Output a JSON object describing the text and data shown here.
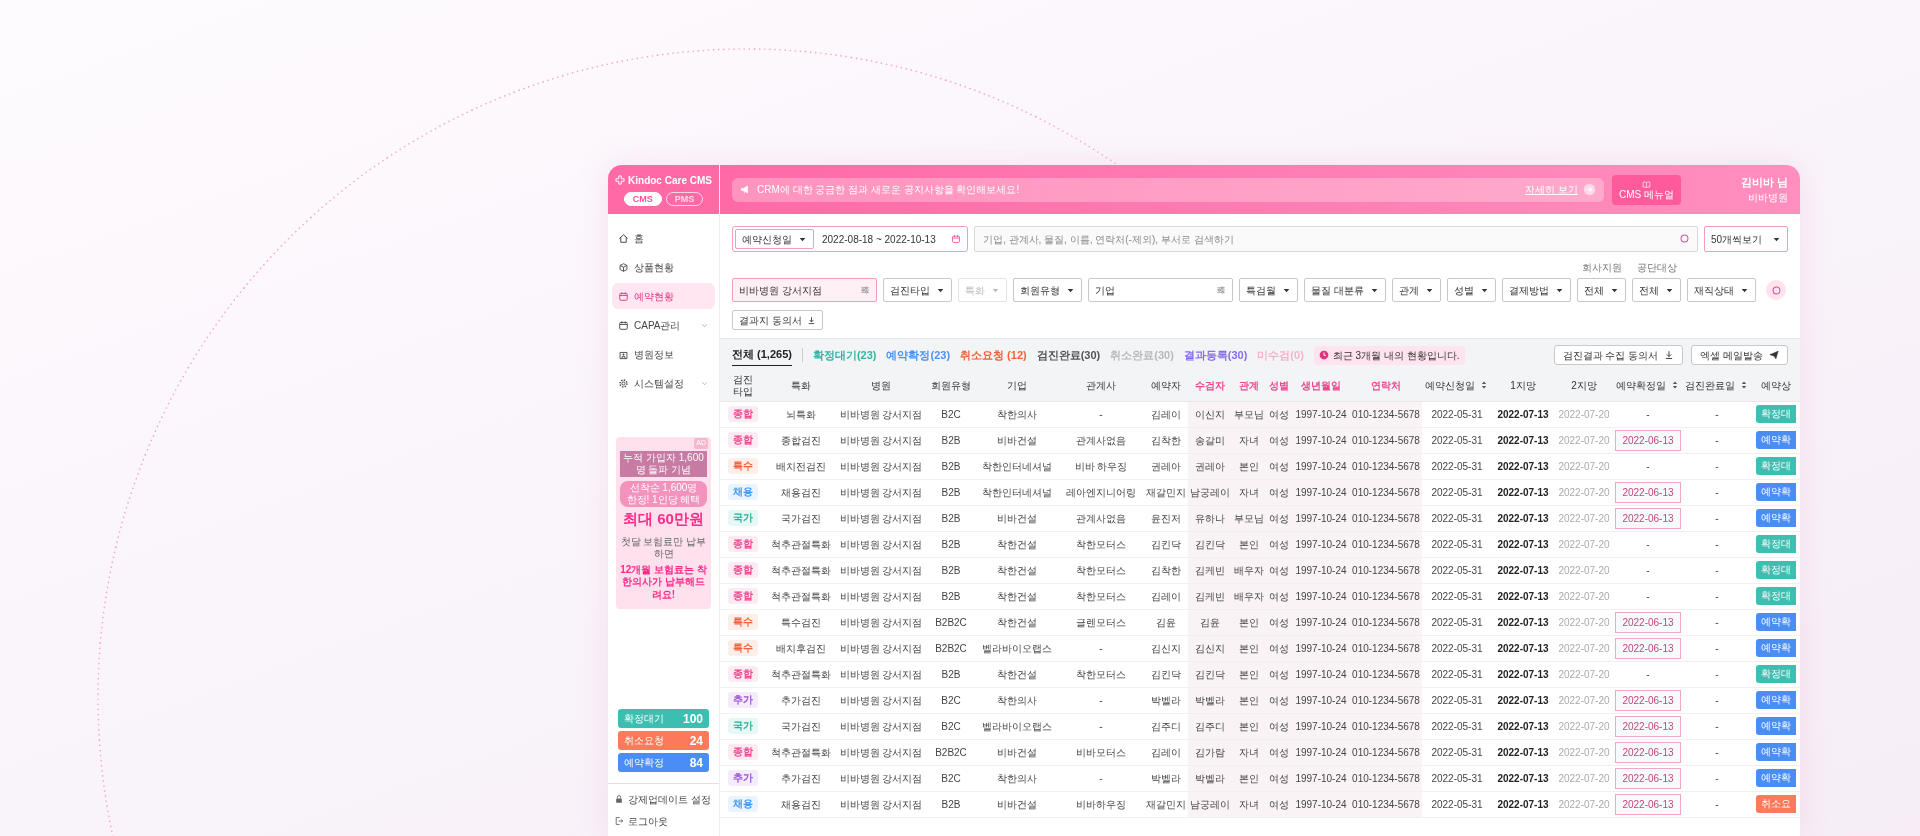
{
  "sidebar": {
    "logo": "Kindoc Care CMS",
    "modes": [
      {
        "label": "CMS",
        "selected": true
      },
      {
        "label": "PMS",
        "selected": false
      }
    ],
    "menu": [
      {
        "label": "홈",
        "kind": "home",
        "selected": false,
        "expandable": false
      },
      {
        "label": "상품현황",
        "kind": "product",
        "selected": false,
        "expandable": false
      },
      {
        "label": "예약현황",
        "kind": "reservation",
        "selected": true,
        "expandable": false
      },
      {
        "label": "CAPA관리",
        "kind": "capa",
        "selected": false,
        "expandable": true
      },
      {
        "label": "병원정보",
        "kind": "hospital",
        "selected": false,
        "expandable": false
      },
      {
        "label": "시스템설정",
        "kind": "settings",
        "selected": false,
        "expandable": true
      }
    ],
    "ad": {
      "tag": "AD",
      "ribbon": "누적 가입자 1,600명 돌파 기념",
      "offer": "선착순 1,600명 한정! 1인당 혜택",
      "headline": "최대 60만원",
      "note": "첫달 보험료만 납부하면",
      "promise": "12개월 보험료는 착한의사가 납부해드려요!"
    },
    "counters": [
      {
        "label": "확정대기",
        "count": "100",
        "color": "#3cbfb0"
      },
      {
        "label": "취소요청",
        "count": "24",
        "color": "#fb7a5b"
      },
      {
        "label": "예약확정",
        "count": "84",
        "color": "#4a8ef5"
      }
    ],
    "links": [
      {
        "label": "강제업데이트 설정",
        "kind": "lock"
      },
      {
        "label": "로그아웃",
        "kind": "logout"
      }
    ]
  },
  "header": {
    "notice": "CRM에 대한 궁금한 점과 새로운 공지사항을 확인해보세요!",
    "more": "자세히 보기",
    "manual": "CMS 메뉴얼",
    "user": "김비바 님",
    "org": "비바병원"
  },
  "filters": {
    "date_type": "예약신청일",
    "date_range": "2022-08-18 ~ 2022-10-13",
    "search_placeholder": "기업, 관계사, 물질, 이름, 연락처(-제외), 부서로 검색하기",
    "page_size": "50개씩보기",
    "controls": [
      {
        "kind": "field",
        "value": "비바병원 강서지점",
        "active": true,
        "disabled": false
      },
      {
        "kind": "select",
        "value": "검진타입",
        "active": false,
        "disabled": false
      },
      {
        "kind": "select",
        "value": "특화",
        "active": false,
        "disabled": true
      },
      {
        "kind": "select",
        "value": "회원유형",
        "active": false,
        "disabled": false
      },
      {
        "kind": "field",
        "value": "기업",
        "active": false,
        "disabled": false
      },
      {
        "kind": "select",
        "value": "특검월",
        "active": false,
        "disabled": false
      },
      {
        "kind": "select",
        "value": "물질 대분류",
        "active": false,
        "disabled": false
      },
      {
        "kind": "select",
        "value": "관계",
        "active": false,
        "disabled": false
      },
      {
        "kind": "select",
        "value": "성별",
        "active": false,
        "disabled": false
      },
      {
        "kind": "select",
        "value": "결제방법",
        "active": false,
        "disabled": false
      },
      {
        "kind": "select",
        "caption": "회사지원",
        "value": "전체",
        "active": false,
        "disabled": false
      },
      {
        "kind": "select",
        "caption": "공단대상",
        "value": "전체",
        "active": false,
        "disabled": false
      },
      {
        "kind": "select",
        "value": "재직상태",
        "active": false,
        "disabled": false
      }
    ],
    "consent_button": "결과지 동의서"
  },
  "status_tabs": [
    {
      "label": "전체 (1,265)",
      "selected": true,
      "color": "#222222"
    },
    {
      "label": "확정대기(23)",
      "selected": false,
      "color": "#2fb5a5"
    },
    {
      "label": "예약확정(23)",
      "selected": false,
      "color": "#4a93f5"
    },
    {
      "label": "취소요청 (12)",
      "selected": false,
      "color": "#f5603c"
    },
    {
      "label": "검진완료(30)",
      "selected": false,
      "color": "#555555"
    },
    {
      "label": "취소완료(30)",
      "selected": false,
      "color": "#b8b8b8"
    },
    {
      "label": "결과등록(30)",
      "selected": false,
      "color": "#8a6cf0"
    },
    {
      "label": "미수검(0)",
      "selected": false,
      "color": "#f5b3cd"
    }
  ],
  "info_pill": "최근 3개월 내의 현황입니다.",
  "actions": [
    {
      "label": "검진결과 수집 동의서",
      "kind": "download"
    },
    {
      "label": "엑셀 메일발송",
      "kind": "send"
    }
  ],
  "table": {
    "columns": [
      {
        "label": "검진 타입",
        "highlight": false,
        "sortable": false
      },
      {
        "label": "특화",
        "highlight": false,
        "sortable": false
      },
      {
        "label": "병원",
        "highlight": false,
        "sortable": false
      },
      {
        "label": "회원유형",
        "highlight": false,
        "sortable": false
      },
      {
        "label": "기업",
        "highlight": false,
        "sortable": false
      },
      {
        "label": "관계사",
        "highlight": false,
        "sortable": false
      },
      {
        "label": "예약자",
        "highlight": false,
        "sortable": false
      },
      {
        "label": "수검자",
        "highlight": true,
        "sortable": false
      },
      {
        "label": "관계",
        "highlight": true,
        "sortable": false
      },
      {
        "label": "성별",
        "highlight": true,
        "sortable": false
      },
      {
        "label": "생년월일",
        "highlight": true,
        "sortable": false
      },
      {
        "label": "연락처",
        "highlight": true,
        "sortable": false
      },
      {
        "label": "예약신청일",
        "highlight": false,
        "sortable": true
      },
      {
        "label": "1지망",
        "highlight": false,
        "sortable": false
      },
      {
        "label": "2지망",
        "highlight": false,
        "sortable": false
      },
      {
        "label": "예약확정일",
        "highlight": false,
        "sortable": true
      },
      {
        "label": "검진완료일",
        "highlight": false,
        "sortable": true
      },
      {
        "label": "예약상",
        "highlight": false,
        "sortable": false
      }
    ],
    "rows": [
      {
        "type": {
          "label": "종합",
          "color": "#f0468f"
        },
        "specialty": "뇌특화",
        "hospital": "비바병원 강서지점",
        "member_type": "B2C",
        "company": "착한의사",
        "affiliate": "-",
        "booker": "김레이",
        "examinee": "이신지",
        "relation": "부모님",
        "sex": "여성",
        "birth": "1997-10-24",
        "phone": "010-1234-5678",
        "requested": "2022-05-31",
        "choice_1": "2022-07-13",
        "choice_2": "2022-07-20",
        "confirmed": {
          "text": "-",
          "boxed": false
        },
        "completed": "-",
        "status": {
          "label": "확정대",
          "color": "#3cbfb0"
        }
      },
      {
        "type": {
          "label": "종합",
          "color": "#f0468f"
        },
        "specialty": "종합검진",
        "hospital": "비바병원 강서지점",
        "member_type": "B2B",
        "company": "비바건설",
        "affiliate": "관계사없음",
        "booker": "김착한",
        "examinee": "송갈미",
        "relation": "자녀",
        "sex": "여성",
        "birth": "1997-10-24",
        "phone": "010-1234-5678",
        "requested": "2022-05-31",
        "choice_1": "2022-07-13",
        "choice_2": "2022-07-20",
        "confirmed": {
          "text": "2022-06-13",
          "boxed": true
        },
        "completed": "-",
        "status": {
          "label": "예약확",
          "color": "#4a8ef5"
        }
      },
      {
        "type": {
          "label": "특수",
          "color": "#f5603c"
        },
        "specialty": "배치전검진",
        "hospital": "비바병원 강서지점",
        "member_type": "B2B",
        "company": "착한인터네셔널",
        "affiliate": "비바 하우징",
        "booker": "권레아",
        "examinee": "권레아",
        "relation": "본인",
        "sex": "여성",
        "birth": "1997-10-24",
        "phone": "010-1234-5678",
        "requested": "2022-05-31",
        "choice_1": "2022-07-13",
        "choice_2": "2022-07-20",
        "confirmed": {
          "text": "-",
          "boxed": false
        },
        "completed": "-",
        "status": {
          "label": "확정대",
          "color": "#3cbfb0"
        }
      },
      {
        "type": {
          "label": "채용",
          "color": "#3f97f5"
        },
        "specialty": "채용검진",
        "hospital": "비바병원 강서지점",
        "member_type": "B2B",
        "company": "착한인터네셔널",
        "affiliate": "레아엔지니어링",
        "booker": "재갈민지",
        "examinee": "남궁레이",
        "relation": "자녀",
        "sex": "여성",
        "birth": "1997-10-24",
        "phone": "010-1234-5678",
        "requested": "2022-05-31",
        "choice_1": "2022-07-13",
        "choice_2": "2022-07-20",
        "confirmed": {
          "text": "2022-06-13",
          "boxed": true
        },
        "completed": "-",
        "status": {
          "label": "예약확",
          "color": "#4a8ef5"
        }
      },
      {
        "type": {
          "label": "국가",
          "color": "#1fb39b"
        },
        "specialty": "국가검진",
        "hospital": "비바병원 강서지점",
        "member_type": "B2B",
        "company": "비바건설",
        "affiliate": "관계사없음",
        "booker": "윤진저",
        "examinee": "유하나",
        "relation": "부모님",
        "sex": "여성",
        "birth": "1997-10-24",
        "phone": "010-1234-5678",
        "requested": "2022-05-31",
        "choice_1": "2022-07-13",
        "choice_2": "2022-07-20",
        "confirmed": {
          "text": "2022-06-13",
          "boxed": true
        },
        "completed": "-",
        "status": {
          "label": "예약확",
          "color": "#4a8ef5"
        }
      },
      {
        "type": {
          "label": "종합",
          "color": "#f0468f"
        },
        "specialty": "척추관절특화",
        "hospital": "비바병원 강서지점",
        "member_type": "B2B",
        "company": "착한건설",
        "affiliate": "착한모터스",
        "booker": "김킨닥",
        "examinee": "김킨닥",
        "relation": "본인",
        "sex": "여성",
        "birth": "1997-10-24",
        "phone": "010-1234-5678",
        "requested": "2022-05-31",
        "choice_1": "2022-07-13",
        "choice_2": "2022-07-20",
        "confirmed": {
          "text": "-",
          "boxed": false
        },
        "completed": "-",
        "status": {
          "label": "확정대",
          "color": "#3cbfb0"
        }
      },
      {
        "type": {
          "label": "종합",
          "color": "#f0468f"
        },
        "specialty": "척추관절특화",
        "hospital": "비바병원 강서지점",
        "member_type": "B2B",
        "company": "착한건설",
        "affiliate": "착한모터스",
        "booker": "김착한",
        "examinee": "김케빈",
        "relation": "배우자",
        "sex": "여성",
        "birth": "1997-10-24",
        "phone": "010-1234-5678",
        "requested": "2022-05-31",
        "choice_1": "2022-07-13",
        "choice_2": "2022-07-20",
        "confirmed": {
          "text": "-",
          "boxed": false
        },
        "completed": "-",
        "status": {
          "label": "확정대",
          "color": "#3cbfb0"
        }
      },
      {
        "type": {
          "label": "종합",
          "color": "#f0468f"
        },
        "specialty": "척추관절특화",
        "hospital": "비바병원 강서지점",
        "member_type": "B2B",
        "company": "착한건설",
        "affiliate": "착한모터스",
        "booker": "김레이",
        "examinee": "김케빈",
        "relation": "배우자",
        "sex": "여성",
        "birth": "1997-10-24",
        "phone": "010-1234-5678",
        "requested": "2022-05-31",
        "choice_1": "2022-07-13",
        "choice_2": "2022-07-20",
        "confirmed": {
          "text": "-",
          "boxed": false
        },
        "completed": "-",
        "status": {
          "label": "확정대",
          "color": "#3cbfb0"
        }
      },
      {
        "type": {
          "label": "특수",
          "color": "#f5603c"
        },
        "specialty": "특수검진",
        "hospital": "비바병원 강서지점",
        "member_type": "B2B2C",
        "company": "착한건설",
        "affiliate": "글렌모터스",
        "booker": "김윤",
        "examinee": "김윤",
        "relation": "본인",
        "sex": "여성",
        "birth": "1997-10-24",
        "phone": "010-1234-5678",
        "requested": "2022-05-31",
        "choice_1": "2022-07-13",
        "choice_2": "2022-07-20",
        "confirmed": {
          "text": "2022-06-13",
          "boxed": true
        },
        "completed": "-",
        "status": {
          "label": "예약확",
          "color": "#4a8ef5"
        }
      },
      {
        "type": {
          "label": "특수",
          "color": "#f5603c"
        },
        "specialty": "배치후검진",
        "hospital": "비바병원 강서지점",
        "member_type": "B2B2C",
        "company": "벨라바이오랩스",
        "affiliate": "-",
        "booker": "김신지",
        "examinee": "김신지",
        "relation": "본인",
        "sex": "여성",
        "birth": "1997-10-24",
        "phone": "010-1234-5678",
        "requested": "2022-05-31",
        "choice_1": "2022-07-13",
        "choice_2": "2022-07-20",
        "confirmed": {
          "text": "2022-06-13",
          "boxed": true
        },
        "completed": "-",
        "status": {
          "label": "예약확",
          "color": "#4a8ef5"
        }
      },
      {
        "type": {
          "label": "종합",
          "color": "#f0468f"
        },
        "specialty": "척추관절특화",
        "hospital": "비바병원 강서지점",
        "member_type": "B2B",
        "company": "착한건설",
        "affiliate": "착한모터스",
        "booker": "김킨닥",
        "examinee": "김킨닥",
        "relation": "본인",
        "sex": "여성",
        "birth": "1997-10-24",
        "phone": "010-1234-5678",
        "requested": "2022-05-31",
        "choice_1": "2022-07-13",
        "choice_2": "2022-07-20",
        "confirmed": {
          "text": "-",
          "boxed": false
        },
        "completed": "-",
        "status": {
          "label": "확정대",
          "color": "#3cbfb0"
        }
      },
      {
        "type": {
          "label": "추가",
          "color": "#9a4fd6"
        },
        "specialty": "추가검진",
        "hospital": "비바병원 강서지점",
        "member_type": "B2C",
        "company": "착한의사",
        "affiliate": "-",
        "booker": "박벨라",
        "examinee": "박벨라",
        "relation": "본인",
        "sex": "여성",
        "birth": "1997-10-24",
        "phone": "010-1234-5678",
        "requested": "2022-05-31",
        "choice_1": "2022-07-13",
        "choice_2": "2022-07-20",
        "confirmed": {
          "text": "2022-06-13",
          "boxed": true
        },
        "completed": "-",
        "status": {
          "label": "예약확",
          "color": "#4a8ef5"
        }
      },
      {
        "type": {
          "label": "국가",
          "color": "#1fb39b"
        },
        "specialty": "국가검진",
        "hospital": "비바병원 강서지점",
        "member_type": "B2C",
        "company": "벨라바이오랩스",
        "affiliate": "-",
        "booker": "김주디",
        "examinee": "김주디",
        "relation": "본인",
        "sex": "여성",
        "birth": "1997-10-24",
        "phone": "010-1234-5678",
        "requested": "2022-05-31",
        "choice_1": "2022-07-13",
        "choice_2": "2022-07-20",
        "confirmed": {
          "text": "2022-06-13",
          "boxed": true
        },
        "completed": "-",
        "status": {
          "label": "예약확",
          "color": "#4a8ef5"
        }
      },
      {
        "type": {
          "label": "종합",
          "color": "#f0468f"
        },
        "specialty": "척추관절특화",
        "hospital": "비바병원 강서지점",
        "member_type": "B2B2C",
        "company": "비바건설",
        "affiliate": "비바모터스",
        "booker": "김레이",
        "examinee": "김가람",
        "relation": "자녀",
        "sex": "여성",
        "birth": "1997-10-24",
        "phone": "010-1234-5678",
        "requested": "2022-05-31",
        "choice_1": "2022-07-13",
        "choice_2": "2022-07-20",
        "confirmed": {
          "text": "2022-06-13",
          "boxed": true
        },
        "completed": "-",
        "status": {
          "label": "예약확",
          "color": "#4a8ef5"
        }
      },
      {
        "type": {
          "label": "추가",
          "color": "#9a4fd6"
        },
        "specialty": "추가검진",
        "hospital": "비바병원 강서지점",
        "member_type": "B2C",
        "company": "착한의사",
        "affiliate": "-",
        "booker": "박벨라",
        "examinee": "박벨라",
        "relation": "본인",
        "sex": "여성",
        "birth": "1997-10-24",
        "phone": "010-1234-5678",
        "requested": "2022-05-31",
        "choice_1": "2022-07-13",
        "choice_2": "2022-07-20",
        "confirmed": {
          "text": "2022-06-13",
          "boxed": true
        },
        "completed": "-",
        "status": {
          "label": "예약확",
          "color": "#4a8ef5"
        }
      },
      {
        "type": {
          "label": "채용",
          "color": "#3f97f5"
        },
        "specialty": "채용검진",
        "hospital": "비바병원 강서지점",
        "member_type": "B2B",
        "company": "비바건설",
        "affiliate": "비바하우징",
        "booker": "재갈민지",
        "examinee": "남궁레이",
        "relation": "자녀",
        "sex": "여성",
        "birth": "1997-10-24",
        "phone": "010-1234-5678",
        "requested": "2022-05-31",
        "choice_1": "2022-07-13",
        "choice_2": "2022-07-20",
        "confirmed": {
          "text": "2022-06-13",
          "boxed": true
        },
        "completed": "-",
        "status": {
          "label": "취소요",
          "color": "#fb7a5b"
        }
      }
    ]
  }
}
